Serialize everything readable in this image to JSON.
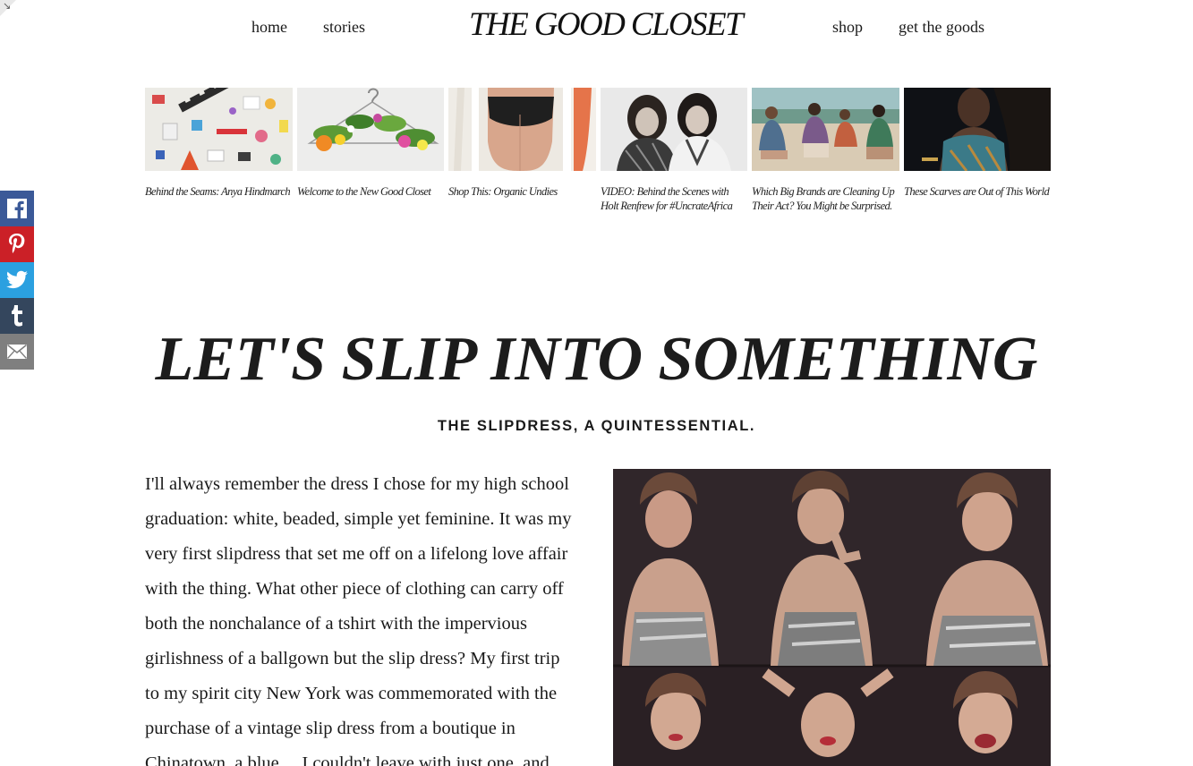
{
  "header": {
    "logo": "THE GOOD CLOSET",
    "nav_left": [
      "home",
      "stories"
    ],
    "nav_right": [
      "shop",
      "get the goods"
    ]
  },
  "share": {
    "icons": [
      "facebook-icon",
      "pinterest-icon",
      "twitter-icon",
      "tumblr-icon",
      "email-icon"
    ],
    "colors": {
      "facebook": "#3b5998",
      "pinterest": "#cb2027",
      "twitter": "#2ba0e0",
      "tumblr": "#34465d",
      "email": "#7f7f7f"
    }
  },
  "stories": [
    {
      "title": "Behind the Seams: Anya Hindmarch"
    },
    {
      "title": "Welcome to the New Good Closet"
    },
    {
      "title": "Shop This: Organic Undies"
    },
    {
      "title": "VIDEO: Behind the Scenes with Holt Renfrew for #UncrateAfrica"
    },
    {
      "title": "Which Big Brands are Cleaning Up Their Act? You Might be Surprised."
    },
    {
      "title": "These Scarves are Out of This World"
    }
  ],
  "article": {
    "headline": "LET'S SLIP INTO SOMETHING",
    "subhead": "THE SLIPDRESS, A QUINTESSENTIAL.",
    "lines": [
      "I'll always remember the dress I chose for my high school",
      "graduation: white, beaded, simple yet feminine. It was my",
      "very first slipdress that set me off on a lifelong love affair",
      "with the thing. What other piece of clothing can carry off",
      "both the nonchalance of a tshirt with the impervious",
      "girlishness of a ballgown but the slip dress? My first trip",
      "to my spirit city New York was commemorated with the",
      "purchase of a vintage slip dress from a boutique in",
      "Chinatown, a blue… I couldn't leave with just one, and"
    ]
  }
}
